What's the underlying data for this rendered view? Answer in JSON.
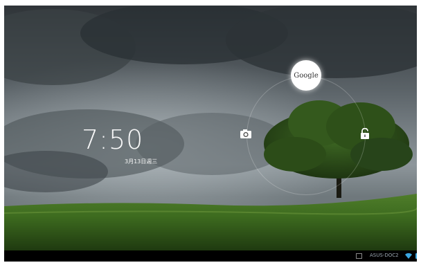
{
  "lockscreen": {
    "time": "7:50",
    "date": "3月13日週三",
    "shortcuts": {
      "google_label": "Google",
      "camera_icon": "camera-icon",
      "unlock_icon": "unlock-icon"
    }
  },
  "status_bar": {
    "network_name": "ASUS-DOC2",
    "icons": [
      "gallery-notification-icon",
      "wifi-icon",
      "battery-icon"
    ]
  },
  "colors": {
    "status_bar_bg": "#000000",
    "battery": "#3aa6e0",
    "text": "#ffffff"
  }
}
